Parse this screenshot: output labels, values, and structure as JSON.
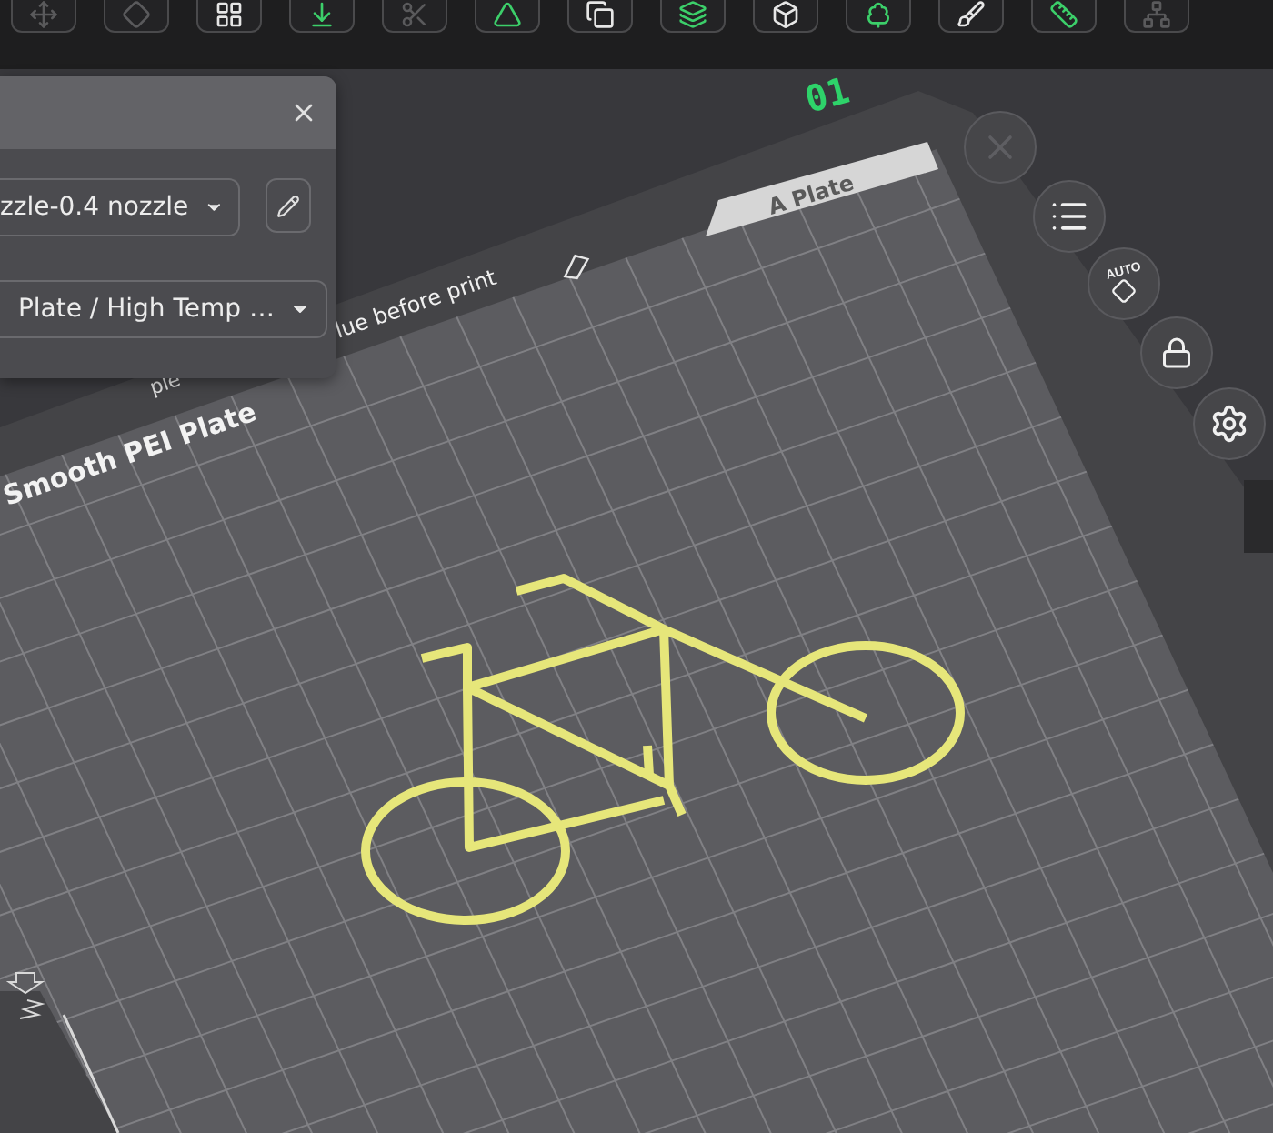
{
  "toolbar": [
    {
      "kind": "move",
      "disabled": true
    },
    {
      "kind": "diamond",
      "disabled": true
    },
    {
      "kind": "arrange",
      "disabled": false
    },
    {
      "kind": "orient",
      "disabled": false
    },
    {
      "kind": "cut",
      "disabled": true
    },
    {
      "kind": "mirror",
      "disabled": false
    },
    {
      "kind": "copy",
      "disabled": false
    },
    {
      "kind": "layers",
      "disabled": false
    },
    {
      "kind": "cube",
      "disabled": false
    },
    {
      "kind": "support",
      "disabled": false
    },
    {
      "kind": "paint",
      "disabled": false
    },
    {
      "kind": "measure",
      "disabled": false
    },
    {
      "kind": "assembly",
      "disabled": true
    }
  ],
  "plate_number": "01",
  "bed": {
    "tab_label": "A Plate",
    "plate_name": "Smooth PEI Plate",
    "note": "lue before print",
    "partial_note": "ple"
  },
  "side_buttons": [
    {
      "kind": "close",
      "disabled": true
    },
    {
      "kind": "list",
      "disabled": false
    },
    {
      "kind": "auto",
      "disabled": false,
      "label": "AUTO"
    },
    {
      "kind": "lock",
      "disabled": false
    },
    {
      "kind": "settings",
      "disabled": false
    }
  ],
  "dialog": {
    "printer_value": "zzle-0.4 nozzle",
    "plate_value": "Plate / High Temp …"
  }
}
